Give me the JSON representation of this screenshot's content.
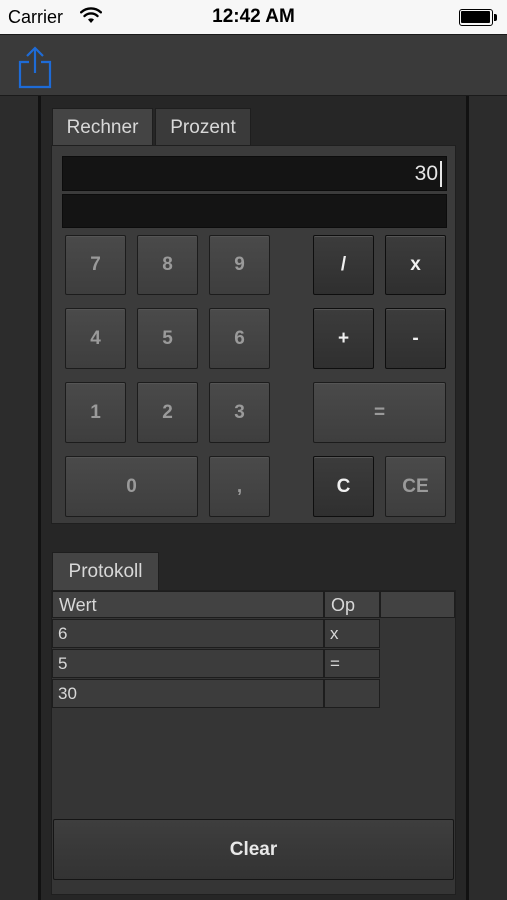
{
  "status_bar": {
    "carrier": "Carrier",
    "time": "12:42 AM"
  },
  "toolbar": {
    "share_icon": "share-icon",
    "accent": "#1e6bd6"
  },
  "tabs": [
    {
      "label": "Rechner",
      "active": true
    },
    {
      "label": "Prozent",
      "active": false
    }
  ],
  "display": {
    "value": "30",
    "secondary": ""
  },
  "keys": {
    "k7": "7",
    "k8": "8",
    "k9": "9",
    "k4": "4",
    "k5": "5",
    "k6": "6",
    "k1": "1",
    "k2": "2",
    "k3": "3",
    "k0": "0",
    "comma": ",",
    "divide": "/",
    "multiply": "x",
    "plus": "+",
    "minus": "-",
    "equals": "=",
    "clear": "C",
    "clear_entry": "CE"
  },
  "log": {
    "tab_label": "Protokoll",
    "columns": [
      "Wert",
      "Op"
    ],
    "rows": [
      {
        "wert": "6",
        "op": "x"
      },
      {
        "wert": "5",
        "op": "="
      },
      {
        "wert": "30",
        "op": ""
      }
    ],
    "clear_label": "Clear"
  }
}
